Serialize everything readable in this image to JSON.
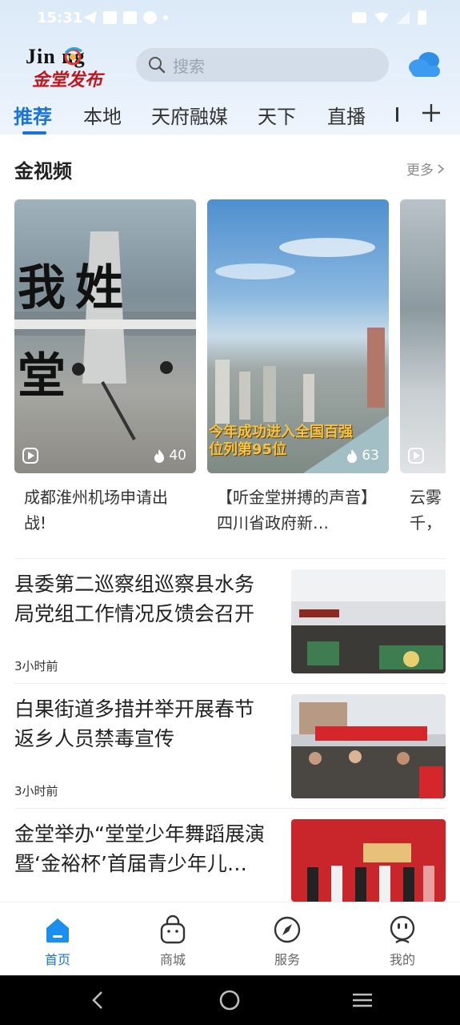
{
  "status_bar": {
    "time": "15:31"
  },
  "header": {
    "logo_text_en": "Jin    ng",
    "logo_text_cn": "金堂发布",
    "search_placeholder": "搜索"
  },
  "tabs": [
    {
      "label": "推荐",
      "active": true
    },
    {
      "label": "本地",
      "active": false
    },
    {
      "label": "天府融媒",
      "active": false
    },
    {
      "label": "天下",
      "active": false
    },
    {
      "label": "直播",
      "active": false
    }
  ],
  "video_section": {
    "title": "金视频",
    "more_label": "更多",
    "videos": [
      {
        "caption": "成都淮州机场申请出战!",
        "hot_count": "40",
        "overlay": "我姓 堂"
      },
      {
        "caption": "【听金堂拼搏的声音】 四川省政府新…",
        "hot_count": "63",
        "overlay": "今年成功进入全国百强 位列第95位"
      },
      {
        "caption": "云雾 千，"
      }
    ]
  },
  "news": [
    {
      "title": "县委第二巡察组巡察县水务局党组工作情况反馈会召开",
      "time": "3小时前"
    },
    {
      "title": "白果街道多措并举开展春节返乡人员禁毒宣传",
      "time": "3小时前"
    },
    {
      "title": "金堂举办“堂堂少年舞蹈展演暨‘金裕杯’首届青少年儿…",
      "time": ""
    }
  ],
  "bottom_nav": [
    {
      "label": "首页",
      "icon": "home-icon",
      "active": true
    },
    {
      "label": "商城",
      "icon": "shop-bag-icon",
      "active": false
    },
    {
      "label": "服务",
      "icon": "compass-icon",
      "active": false
    },
    {
      "label": "我的",
      "icon": "profile-face-icon",
      "active": false
    }
  ],
  "colors": {
    "accent": "#1a73d9",
    "header_bg": "#dbeaf8"
  }
}
